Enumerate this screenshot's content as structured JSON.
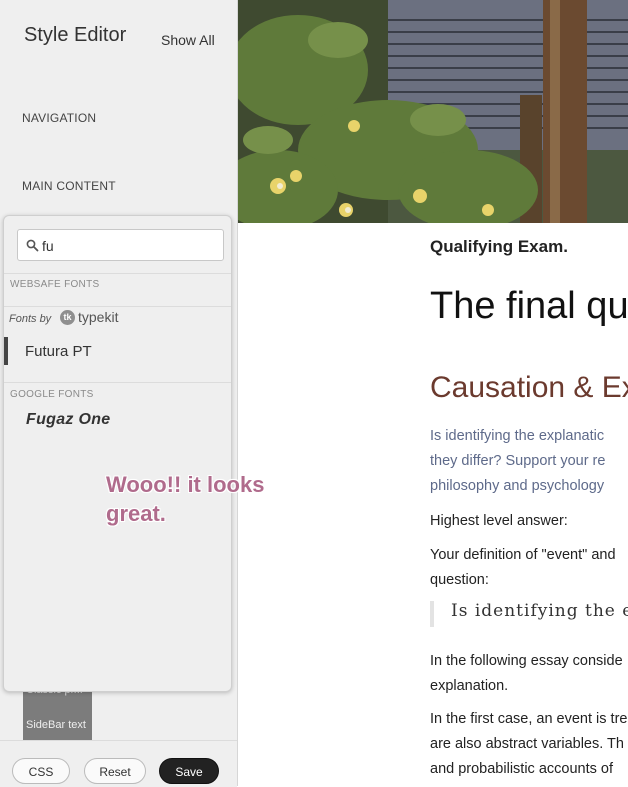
{
  "sidebar": {
    "title": "Style Editor",
    "show_all": "Show All",
    "sections": {
      "navigation": "NAVIGATION",
      "main_content": "MAIN CONTENT"
    },
    "thumbnail_text": [
      "Classic pr...",
      "SideBar text"
    ]
  },
  "font_picker": {
    "search_value": "fu",
    "websafe_label": "WEBSAFE FONTS",
    "fonts_by": "Fonts by",
    "provider": "typekit",
    "typekit_fonts": [
      "Futura PT"
    ],
    "google_label": "GOOGLE FONTS",
    "google_fonts": [
      "Fugaz One"
    ]
  },
  "annotation": "Wooo!! it looks great.",
  "toolbar": {
    "css": "CSS",
    "reset": "Reset",
    "save": "Save"
  },
  "content": {
    "small_title": "Qualifying Exam.",
    "heading": "The final que",
    "subheading": "Causation & Ex",
    "para1": "Is identifying the explanatic\nthey differ? Support your re\nphilosophy and psychology",
    "para2": "Highest level answer:",
    "para3": "Your definition of \"event\" and\nquestion:",
    "quote": "Is identifying the e",
    "para4": "In the following essay conside\nexplanation.",
    "para5": "In the first case, an event is tre\nare also abstract variables. Th\nand probabilistic accounts of"
  },
  "colors": {
    "annotation": "#b06b8c",
    "link_text": "#5e6a8a",
    "subheading": "#6b3a2e",
    "save_button": "#222222"
  }
}
